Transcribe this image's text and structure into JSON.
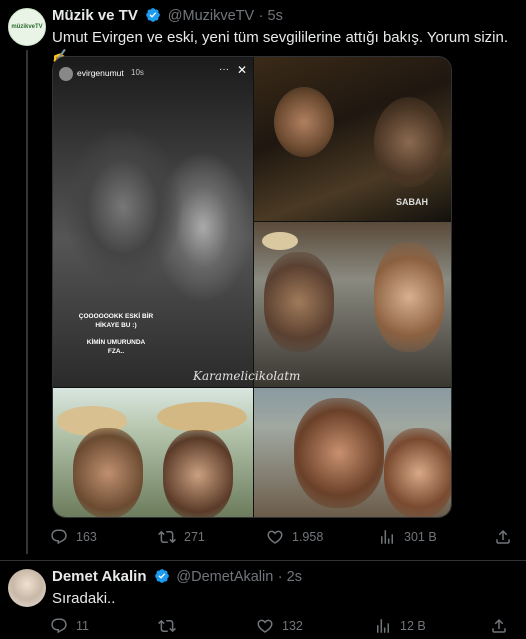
{
  "tweet1": {
    "name": "Müzik ve TV",
    "handle": "@MuzikveTV",
    "time": "5s",
    "text": "Umut Evirgen ve eski, yeni tüm sevgililerine attığı bakış. Yorum sizin. ✍️",
    "avatar_text": "müzikveTV",
    "story": {
      "username": "evirgenumut",
      "time": "10s",
      "sticker_line1": "ÇOOOOOOKK ESKİ BİR",
      "sticker_line2": "HİKAYE BU :)",
      "sticker_line3": "KİMİN UMURUNDA",
      "sticker_line4": "FZA..",
      "watermark": "Karamelicikolatm"
    },
    "sabah_watermark": "SABAH",
    "actions": {
      "replies": "163",
      "retweets": "271",
      "likes": "1.958",
      "views": "301 B"
    }
  },
  "tweet2": {
    "name": "Demet Akalin",
    "handle": "@DemetAkalin",
    "time": "2s",
    "text": "Sıradaki..",
    "actions": {
      "replies": "11",
      "retweets": "",
      "likes": "132",
      "views": "12 B"
    }
  },
  "colors": {
    "background": "#000000",
    "text": "#e7e9ea",
    "muted": "#71767b",
    "verified": "#1d9bf0",
    "divider": "#2f3336"
  }
}
